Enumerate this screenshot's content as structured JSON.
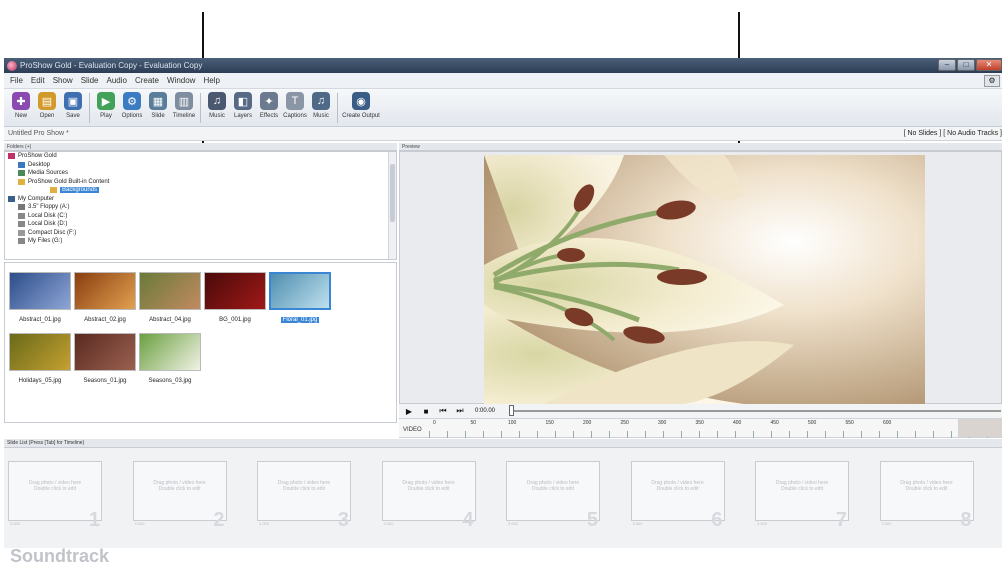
{
  "window": {
    "title": "ProShow Gold - Evaluation Copy - Evaluation Copy",
    "buttons": [
      "–",
      "□",
      "✕"
    ]
  },
  "menu": [
    "File",
    "Edit",
    "Show",
    "Slide",
    "Audio",
    "Create",
    "Window",
    "Help"
  ],
  "toolbar": [
    {
      "label": "New",
      "icon": "new-icon",
      "color": "#8a4ab0"
    },
    {
      "label": "Open",
      "icon": "open-icon",
      "color": "#d29a2a"
    },
    {
      "label": "Save",
      "icon": "save-icon",
      "color": "#3f6fb0"
    },
    {
      "label": "Play",
      "icon": "play-icon",
      "color": "#43a25a"
    },
    {
      "label": "Options",
      "icon": "options-icon",
      "color": "#3b7cc2"
    },
    {
      "label": "Slide",
      "icon": "slide-icon",
      "color": "#5a7e9a"
    },
    {
      "label": "Timeline",
      "icon": "timeline-icon",
      "color": "#7f8da0"
    },
    {
      "label": "Music",
      "icon": "music-icon",
      "color": "#4a5870"
    },
    {
      "label": "Layers",
      "icon": "layers-icon",
      "color": "#566a86"
    },
    {
      "label": "Effects",
      "icon": "effects-icon",
      "color": "#6b7a8f"
    },
    {
      "label": "Captions",
      "icon": "captions-icon",
      "color": "#8a96a6"
    },
    {
      "label": "Music",
      "icon": "music-icon",
      "color": "#4e6a86"
    },
    {
      "label": "Create Output",
      "icon": "create-output-icon",
      "color": "#3a5d86"
    }
  ],
  "show": {
    "name": "Untitled Pro Show *",
    "status": "[ No Slides ] [ No Audio Tracks ]"
  },
  "panels": {
    "folders_header": "Folders (+)",
    "preview_header": "Preview",
    "slide_list_header": "Slide List (Press [Tab] for Timeline)"
  },
  "folders": [
    {
      "label": "ProShow Gold",
      "indent": 0,
      "icon": "proshow-icon"
    },
    {
      "label": "Desktop",
      "indent": 1,
      "icon": "desktop-icon"
    },
    {
      "label": "Media Sources",
      "indent": 1,
      "icon": "media-icon"
    },
    {
      "label": "ProShow Gold Built-in Content",
      "indent": 1,
      "icon": "folder-icon"
    },
    {
      "label": "Backgrounds",
      "indent": 2,
      "icon": "folder-icon",
      "selected": true
    },
    {
      "label": "My Computer",
      "indent": 0,
      "icon": "computer-icon"
    },
    {
      "label": "3.5\" Floppy (A:)",
      "indent": 1,
      "icon": "floppy-icon"
    },
    {
      "label": "Local Disk (C:)",
      "indent": 1,
      "icon": "disk-icon"
    },
    {
      "label": "Local Disk (D:)",
      "indent": 1,
      "icon": "disk-icon"
    },
    {
      "label": "Compact Disc (F:)",
      "indent": 1,
      "icon": "cd-icon"
    },
    {
      "label": "My Files (G:)",
      "indent": 1,
      "icon": "disk-icon"
    }
  ],
  "files": [
    {
      "label": "Abstract_01.jpg",
      "colors": [
        "#2d4d8a",
        "#8ea6d6"
      ]
    },
    {
      "label": "Abstract_02.jpg",
      "colors": [
        "#8a3e10",
        "#e2a150"
      ]
    },
    {
      "label": "Abstract_04.jpg",
      "colors": [
        "#6a7a3a",
        "#c28a60"
      ]
    },
    {
      "label": "BG_001.jpg",
      "colors": [
        "#4a0a0a",
        "#a01818"
      ]
    },
    {
      "label": "Floral_01.jpg",
      "colors": [
        "#4f8fb0",
        "#bfe0ee"
      ],
      "selected": true
    },
    {
      "label": "Holidays_05.jpg",
      "colors": [
        "#6a6a1a",
        "#c4a030"
      ]
    },
    {
      "label": "Seasons_01.jpg",
      "colors": [
        "#5a2a20",
        "#9a6050"
      ]
    },
    {
      "label": "Seasons_03.jpg",
      "colors": [
        "#6aa040",
        "#f2f2e6"
      ]
    }
  ],
  "transport": {
    "buttons": [
      "▶",
      "■",
      "⏮",
      "⏭"
    ],
    "timecode": "0:00.00"
  },
  "ruler": {
    "track_label": "VIDEO",
    "marks": [
      "0",
      "50",
      "100",
      "150",
      "200",
      "250",
      "300",
      "350",
      "400",
      "450",
      "500",
      "550",
      "600"
    ]
  },
  "slide_placeholder": "Drag photo / video here\nDouble click to edit",
  "slide_duration": "3.000",
  "slots": [
    "1",
    "2",
    "3",
    "4",
    "5",
    "6",
    "7",
    "8"
  ],
  "soundtrack": "Soundtrack"
}
